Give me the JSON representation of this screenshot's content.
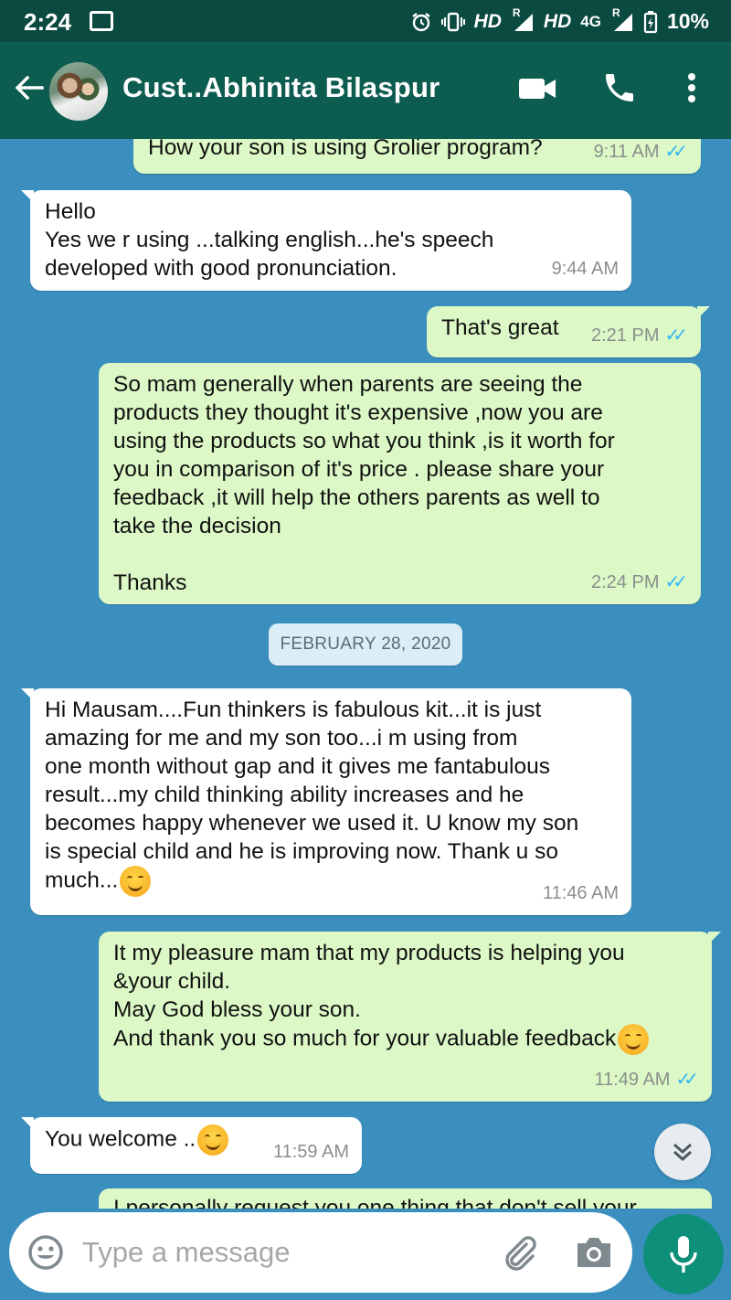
{
  "status_bar": {
    "time": "2:24",
    "network_1": "HD",
    "roaming_1": "R",
    "network_2": "HD",
    "network_type": "4G",
    "roaming_2": "R",
    "battery": "10%"
  },
  "header": {
    "contact_name": "Cust..Abhinita Bilaspur"
  },
  "messages": [
    {
      "direction": "out",
      "text": "How your son is using Grolier program?",
      "time": "9:11 AM",
      "read": true
    },
    {
      "direction": "in",
      "text": "Hello\nYes we r using ...talking english...he's speech\ndeveloped with good pronunciation.",
      "time": "9:44 AM"
    },
    {
      "direction": "out",
      "text": "That's great",
      "time": "2:21 PM",
      "read": true
    },
    {
      "direction": "out",
      "text": "So mam generally when parents are seeing the\nproducts they thought it's expensive ,now you are\nusing the products so what you think ,is it worth for\nyou in comparison of it's price . please share your\nfeedback ,it will help the others parents as well to\ntake the decision\n\nThanks",
      "time": "2:24 PM",
      "read": true
    },
    {
      "direction": "in",
      "text": "Hi Mausam....Fun thinkers is fabulous kit...it is just\namazing for me and my son too...i m using from\none month without gap and it gives me fantabulous\nresult...my child thinking ability increases and he\nbecomes happy whenever we used it. U know my son\nis special child and he is improving now. Thank u so\nmuch...",
      "time": "11:46 AM",
      "emoji": "smiling-face"
    },
    {
      "direction": "out",
      "text": "It my pleasure mam that my products is helping you\n&your child.\nMay God bless your son.\nAnd thank you so much for your valuable feedback",
      "time": "11:49 AM",
      "read": true,
      "emoji": "smiling-face"
    },
    {
      "direction": "in",
      "text": "You welcome ..",
      "time": "11:59 AM",
      "emoji": "smiling-face"
    },
    {
      "direction": "out",
      "text": "I personally request you one thing that don't sell your",
      "partial": true
    }
  ],
  "date_divider": "FEBRUARY 28, 2020",
  "input": {
    "placeholder": "Type a message"
  },
  "colors": {
    "header": "#0d5c50",
    "status_bar": "#0b4a40",
    "wallpaper": "#3a8fbf",
    "outgoing_bubble": "#dcf8c6",
    "incoming_bubble": "#ffffff",
    "read_ticks": "#34b7f1",
    "mic_button": "#0d8f79"
  },
  "icons": [
    "back-arrow-icon",
    "video-call-icon",
    "phone-icon",
    "more-vert-icon",
    "emoji-icon",
    "attach-icon",
    "camera-icon",
    "mic-icon",
    "double-chevron-down-icon"
  ]
}
